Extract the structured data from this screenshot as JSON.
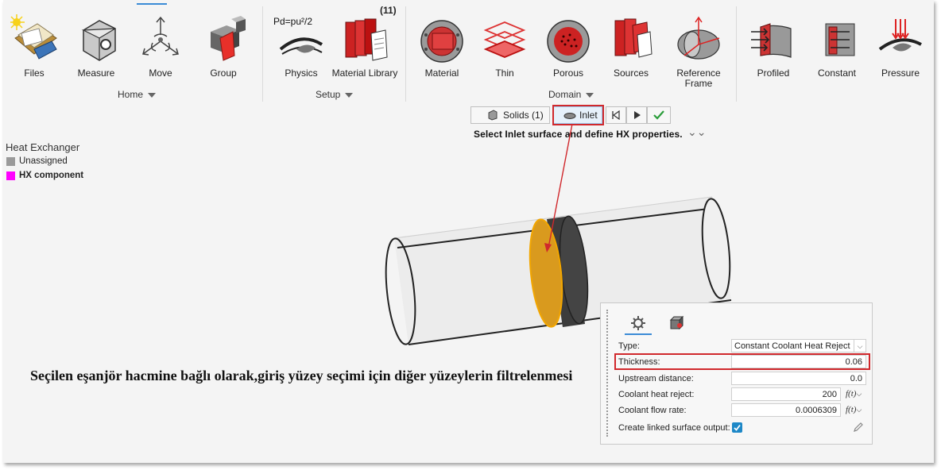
{
  "ribbon": {
    "home": {
      "group_label": "Home",
      "tools": [
        {
          "label": "Files",
          "icon": "files-icon"
        },
        {
          "label": "Measure",
          "icon": "measure-icon"
        },
        {
          "label": "Move",
          "icon": "move-icon"
        },
        {
          "label": "Group",
          "icon": "group-icon"
        }
      ]
    },
    "setup": {
      "group_label": "Setup",
      "tools": [
        {
          "label": "Physics",
          "icon": "physics-icon",
          "icon_text": "Pd=pu²/2"
        },
        {
          "label": "Material Library",
          "icon": "material-library-icon",
          "badge": "(11)"
        }
      ]
    },
    "domain": {
      "group_label": "Domain",
      "tools": [
        {
          "label": "Material",
          "icon": "material-icon"
        },
        {
          "label": "Thin",
          "icon": "thin-icon"
        },
        {
          "label": "Porous",
          "icon": "porous-icon"
        },
        {
          "label": "Sources",
          "icon": "sources-icon"
        },
        {
          "label": "Reference Frame",
          "icon": "reference-frame-icon"
        }
      ]
    },
    "boundary": {
      "tools": [
        {
          "label": "Profiled",
          "icon": "profiled-icon"
        },
        {
          "label": "Constant",
          "icon": "constant-icon"
        },
        {
          "label": "Pressure",
          "icon": "pressure-icon"
        }
      ]
    }
  },
  "stepbar": {
    "solids_label": "Solids (1)",
    "inlet_label": "Inlet",
    "instruction": "Select Inlet surface and define HX properties."
  },
  "legend": {
    "title": "Heat Exchanger",
    "items": [
      {
        "label": "Unassigned",
        "color": "#9a9a9a"
      },
      {
        "label": "HX component",
        "color": "#ff00ff"
      }
    ]
  },
  "caption": "Seçilen eşanjör hacmine bağlı olarak,giriş yüzey seçimi için diğer yüzeylerin filtrelenmesi",
  "properties": {
    "rows": [
      {
        "label": "Type:",
        "value": "Constant Coolant Heat Reject"
      },
      {
        "label": "Thickness:",
        "value": "0.06"
      },
      {
        "label": "Upstream distance:",
        "value": "0.0"
      },
      {
        "label": "Coolant heat reject:",
        "value": "200",
        "fx": "f(t)"
      },
      {
        "label": "Coolant flow rate:",
        "value": "0.0006309",
        "fx": "f(t)"
      },
      {
        "label": "Create linked surface output:",
        "checked": true
      }
    ]
  },
  "colors": {
    "highlight": "#d0282c",
    "face_fill": "#d99a1e",
    "check_blue": "#1e88c7",
    "accept_green": "#2a9d3a"
  }
}
